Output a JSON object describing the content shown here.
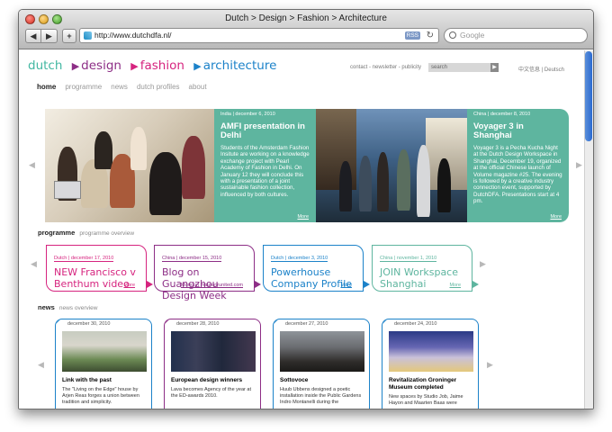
{
  "browser": {
    "title": "Dutch > Design > Fashion > Architecture",
    "url": "http://www.dutchdfa.nl/",
    "rss": "RSS",
    "search_placeholder": "Google",
    "back": "◀",
    "forward": "▶",
    "add": "+"
  },
  "logo": {
    "dutch": "dutch",
    "design": "design",
    "fashion": "fashion",
    "architecture": "architecture"
  },
  "top_links": "contact  -  newsletter  -  publicity",
  "site_search_placeholder": "search",
  "languages": "中文信息  |  Deutsch",
  "nav": [
    "home",
    "programme",
    "news",
    "dutch profiles",
    "about"
  ],
  "hero": {
    "slide1": {
      "tag": "India | december 6, 2010",
      "title": "AMFI presentation in Delhi",
      "text": "Students of the Amsterdam Fashion Insitute are working on a knowledge exchange project with Pearl Academy of Fashion in Delhi. On January 12 they will conclude this with a presentation of a joint sustainable fashion collection, influenced by both cultures.",
      "more": "More"
    },
    "slide2": {
      "tag": "China | december 8, 2010",
      "title": "Voyager 3 in Shanghai",
      "text": "Voyager 3 is a Pecha Kucha Night at the Dutch Design Workspace in Shanghai, December 19, organized at the official Chinese launch of Volume magazine #25. The evening is followed by a creative industry connection event, supported by DutchDFA. Presentations start at 4 pm.",
      "more": "More"
    }
  },
  "programme": {
    "heading": "programme",
    "overview": "programme overview",
    "cards": [
      {
        "tag": "Dutch | december 17, 2010",
        "title": "NEW Francisco v Benthum video",
        "more": "More",
        "color": "#d6247f"
      },
      {
        "tag": "China | december 15, 2010",
        "title": "Blog on Guangzhou Design Week",
        "more": "More on mauronrunited.com",
        "color": "#8d2e86"
      },
      {
        "tag": "Dutch | december 3, 2010",
        "title": "Powerhouse Company Profile",
        "more": "More",
        "color": "#1c82c9"
      },
      {
        "tag": "China | november 1, 2010",
        "title": "JOIN Workspace Shanghai",
        "more": "More",
        "color": "#5eb59f"
      }
    ]
  },
  "news": {
    "heading": "news",
    "overview": "news overview",
    "cards": [
      {
        "date": "december 30, 2010",
        "title": "Link with the past",
        "text": "The \"Living on the Edge\" house by Arjen Reas forges a union between tradition and simplicity.",
        "color": "#1c82c9"
      },
      {
        "date": "december 28, 2010",
        "title": "European design winners",
        "text": "Lava becomes Agency of the year at the ED-awards 2010.",
        "color": "#8d2e86"
      },
      {
        "date": "december 27, 2010",
        "title": "Sottovoce",
        "text": "Huub Ubbens designed a poetic installation inside the Public Gardens Indro Montanelli during the",
        "color": "#1c82c9"
      },
      {
        "date": "december 24, 2010",
        "title": "Revitalization Groninger Museum completed",
        "text": "New spaces by Studio Job, Jaime Hayon and Maarten Baas were",
        "color": "#1c82c9"
      }
    ]
  }
}
